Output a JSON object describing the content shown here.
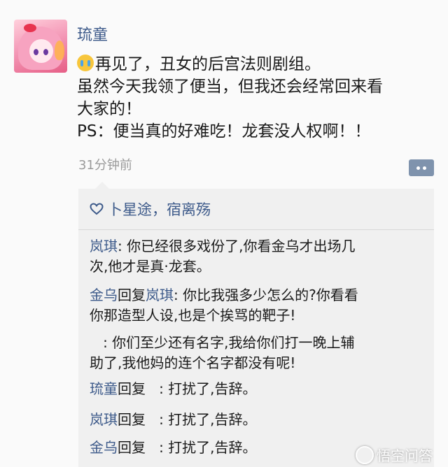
{
  "post": {
    "author": "琉童",
    "lines": [
      "再见了，丑女的后宫法则剧组。",
      "虽然今天我领了便当，但我还会经常回来看",
      "大家的！",
      "PS：便当真的好难吃！龙套没人权啊！！"
    ],
    "time": "31分钟前"
  },
  "likes": {
    "names": "卜星途，宿离殇"
  },
  "comments": [
    {
      "author": "岚琪",
      "sep": ": ",
      "line1": "你已经很多戏份了,你看金乌才出场几",
      "line2": "次,他才是真·龙套。"
    },
    {
      "author": "金乌",
      "reply_word": "回复",
      "target": "岚琪",
      "sep": ": ",
      "line1": "你比我强多少怎么的?你看看",
      "line2": "你那造型人设,也是个挨骂的靶子!"
    },
    {
      "line1": "   : 你们至少还有名字,我给你们打一晚上辅",
      "line2": "助了,我他妈的连个名字都没有呢!"
    },
    {
      "author": "琉童",
      "reply_word": "回复",
      "text": "   : 打扰了,告辞。"
    },
    {
      "author": "岚琪",
      "reply_word": "回复",
      "text": "   : 打扰了,告辞。"
    },
    {
      "author": "金乌",
      "reply_word": "回复",
      "text": "   : 打扰了,告辞。"
    }
  ],
  "watermark": {
    "text": "悟空问答"
  },
  "icons": {
    "cry": "crying-face-icon",
    "heart": "heart-outline-icon",
    "comment": "comment-dots-icon"
  },
  "colors": {
    "name_blue": "#3d5a8a",
    "panel_bg": "#f0f0f0",
    "time_gray": "#9a9a9a"
  }
}
